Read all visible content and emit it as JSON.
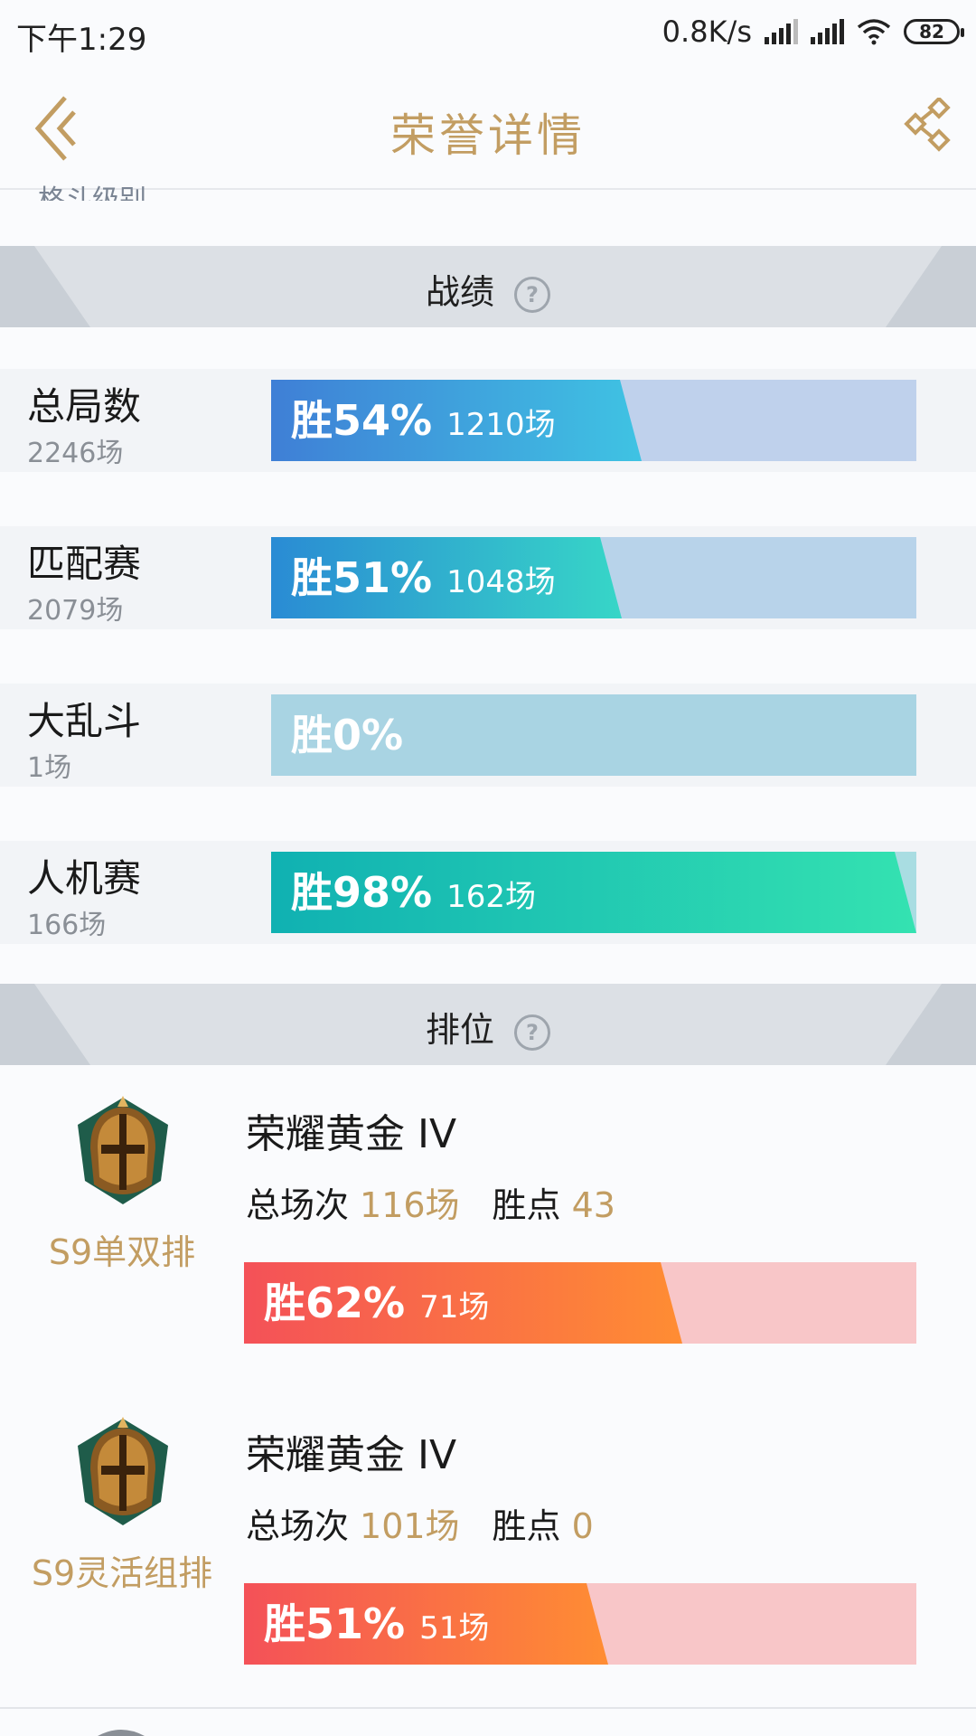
{
  "status": {
    "time": "下午1:29",
    "speed": "0.8K/s",
    "battery": "82"
  },
  "header": {
    "title": "荣誉详情",
    "peek_text": "格斗级别"
  },
  "sections": {
    "record": "战绩",
    "ranked": "排位",
    "help_glyph": "?"
  },
  "stats": [
    {
      "name": "总局数",
      "count": "2246场",
      "pct_label": "胜54%",
      "wins": "1210场",
      "win_rate": 54,
      "fill_from": "#3f7fd6",
      "fill_to": "#3fc3e3",
      "track": "#bfd1ec"
    },
    {
      "name": "匹配赛",
      "count": "2079场",
      "pct_label": "胜51%",
      "wins": "1048场",
      "win_rate": 51,
      "fill_from": "#2a8bd4",
      "fill_to": "#37d6c7",
      "track": "#b8d3ea"
    },
    {
      "name": "大乱斗",
      "count": "1场",
      "pct_label": "胜0%",
      "wins": "",
      "win_rate": 0,
      "fill_from": "#a9d4e3",
      "fill_to": "#a9d4e3",
      "track": "#a9d4e3"
    },
    {
      "name": "人机赛",
      "count": "166场",
      "pct_label": "胜98%",
      "wins": "162场",
      "win_rate": 98,
      "fill_from": "#10b1b2",
      "fill_to": "#34e2b1",
      "track": "#a9dde2"
    }
  ],
  "ranks": [
    {
      "season": "S9单双排",
      "tier": "荣耀黄金 IV",
      "total_label": "总场次",
      "total": "116场",
      "points_label": "胜点",
      "points": "43",
      "pct_label": "胜62%",
      "wins": "71场",
      "win_rate": 62
    },
    {
      "season": "S9灵活组排",
      "tier": "荣耀黄金 IV",
      "total_label": "总场次",
      "total": "101场",
      "points_label": "胜点",
      "points": "0",
      "pct_label": "胜51%",
      "wins": "51场",
      "win_rate": 51
    }
  ],
  "colors": {
    "accent": "#c29d62",
    "rank_fill_from": "#f45158",
    "rank_fill_to": "#ff8d33",
    "rank_track": "#f8c6c8"
  },
  "icons": {
    "back": "chevron-left-icon",
    "share": "share-icon",
    "help": "help-circle-icon",
    "helmet": "rank-helmet-icon"
  }
}
